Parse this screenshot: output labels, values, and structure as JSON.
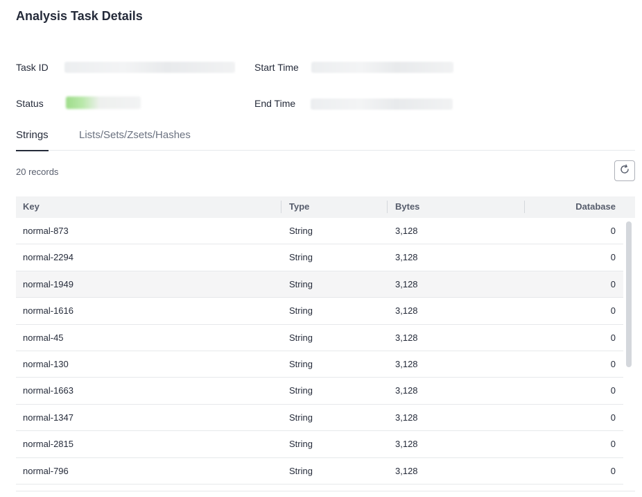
{
  "page": {
    "title": "Analysis Task Details"
  },
  "info": {
    "task_id_label": "Task ID",
    "start_time_label": "Start Time",
    "status_label": "Status",
    "end_time_label": "End Time"
  },
  "tabs": [
    {
      "label": "Strings",
      "active": true
    },
    {
      "label": "Lists/Sets/Zsets/Hashes",
      "active": false
    }
  ],
  "records_text": "20 records",
  "refresh_icon": "refresh-icon",
  "table": {
    "columns": [
      "Key",
      "Type",
      "Bytes",
      "Database"
    ],
    "rows": [
      [
        "normal-873",
        "String",
        "3,128",
        "0"
      ],
      [
        "normal-2294",
        "String",
        "3,128",
        "0"
      ],
      [
        "normal-1949",
        "String",
        "3,128",
        "0"
      ],
      [
        "normal-1616",
        "String",
        "3,128",
        "0"
      ],
      [
        "normal-45",
        "String",
        "3,128",
        "0"
      ],
      [
        "normal-130",
        "String",
        "3,128",
        "0"
      ],
      [
        "normal-1663",
        "String",
        "3,128",
        "0"
      ],
      [
        "normal-1347",
        "String",
        "3,128",
        "0"
      ],
      [
        "normal-2815",
        "String",
        "3,128",
        "0"
      ],
      [
        "normal-796",
        "String",
        "3,128",
        "0"
      ]
    ],
    "highlighted_row": 2
  }
}
